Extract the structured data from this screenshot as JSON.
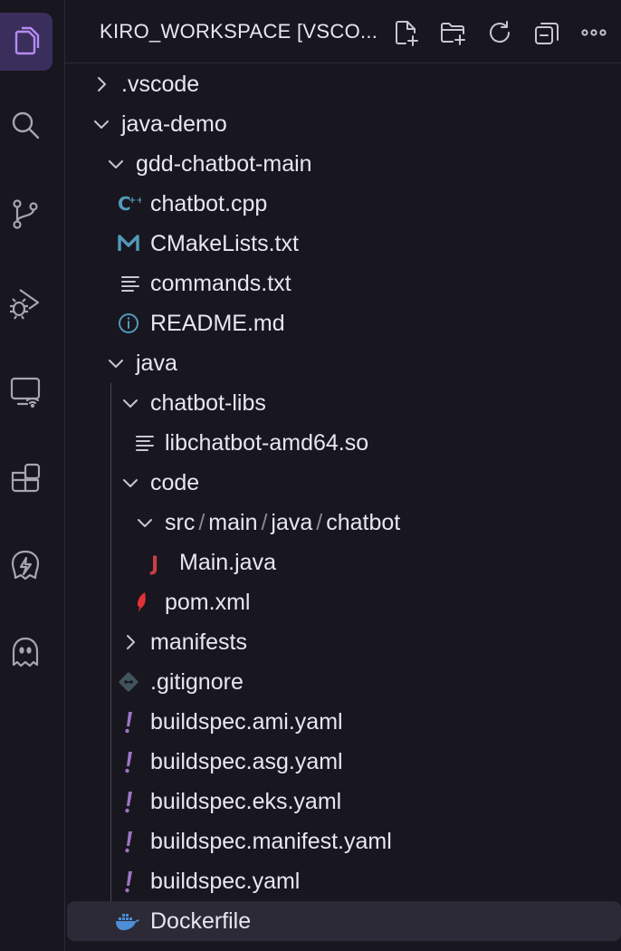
{
  "explorer": {
    "title": "KIRO_WORKSPACE [VSCO...",
    "actions": [
      {
        "name": "new-file-button",
        "icon": "new-file-icon"
      },
      {
        "name": "new-folder-button",
        "icon": "new-folder-icon"
      },
      {
        "name": "refresh-button",
        "icon": "refresh-icon"
      },
      {
        "name": "collapse-all-button",
        "icon": "collapse-all-icon"
      },
      {
        "name": "more-actions-button",
        "icon": "ellipsis-icon"
      }
    ]
  },
  "activity_bar": [
    {
      "name": "explorer",
      "icon": "files-icon",
      "active": true
    },
    {
      "name": "search",
      "icon": "search-icon"
    },
    {
      "name": "source-control",
      "icon": "source-control-icon"
    },
    {
      "name": "run-debug",
      "icon": "debug-icon"
    },
    {
      "name": "remote-explorer",
      "icon": "remote-icon"
    },
    {
      "name": "extensions",
      "icon": "extensions-icon"
    },
    {
      "name": "kiro-spec",
      "icon": "kiro-lightning-icon"
    },
    {
      "name": "kiro",
      "icon": "kiro-ghost-icon"
    }
  ],
  "tree": {
    "vscode": ".vscode",
    "java_demo": "java-demo",
    "gdd_chatbot_main": "gdd-chatbot-main",
    "chatbot_cpp": "chatbot.cpp",
    "cmakelists": "CMakeLists.txt",
    "commands": "commands.txt",
    "readme": "README.md",
    "java": "java",
    "chatbot_libs": "chatbot-libs",
    "libchatbot": "libchatbot-amd64.so",
    "code": "code",
    "path_parts": [
      "src",
      "main",
      "java",
      "chatbot"
    ],
    "path_sep": "/",
    "main_java": "Main.java",
    "pom": "pom.xml",
    "manifests": "manifests",
    "gitignore": ".gitignore",
    "buildspec_ami": "buildspec.ami.yaml",
    "buildspec_asg": "buildspec.asg.yaml",
    "buildspec_eks": "buildspec.eks.yaml",
    "buildspec_manifest": "buildspec.manifest.yaml",
    "buildspec": "buildspec.yaml",
    "dockerfile": "Dockerfile"
  },
  "colors": {
    "background": "#18161f",
    "accent": "#b48cf2",
    "selected_row": "#2c2a36",
    "cpp_icon": "#519aba",
    "yaml_icon": "#a074c4",
    "java_icon": "#cc3e44",
    "maven_icon": "#e23237",
    "git_icon": "#41535b",
    "docker_icon": "#4c8fd6"
  }
}
